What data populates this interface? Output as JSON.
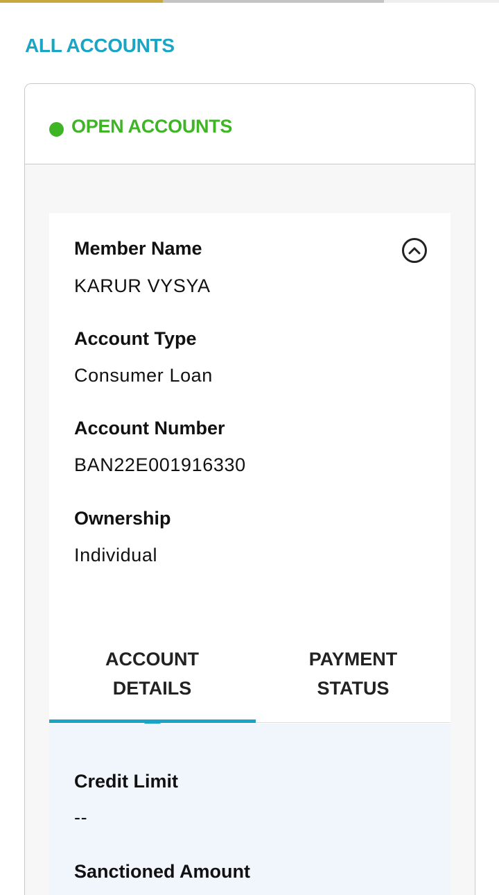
{
  "header": {
    "all_accounts_link": "ALL ACCOUNTS"
  },
  "colors": {
    "accent": "#1aa5c4",
    "open_status": "#3db525",
    "progress_active": "#c8a83e",
    "progress_inactive": "#c4c4c4"
  },
  "card": {
    "status_title": "OPEN ACCOUNTS",
    "collapse_icon": "chevron-up-circle-icon",
    "fields": [
      {
        "label": "Member Name",
        "value": "KARUR VYSYA"
      },
      {
        "label": "Account Type",
        "value": "Consumer Loan"
      },
      {
        "label": "Account Number",
        "value": "BAN22E001916330"
      },
      {
        "label": "Ownership",
        "value": "Individual"
      }
    ],
    "tabs": [
      {
        "label": "ACCOUNT\nDETAILS",
        "active": true
      },
      {
        "label": "PAYMENT\nSTATUS",
        "active": false
      }
    ],
    "details": [
      {
        "label": "Credit Limit",
        "value": "--"
      },
      {
        "label": "Sanctioned Amount",
        "value": ""
      }
    ]
  }
}
